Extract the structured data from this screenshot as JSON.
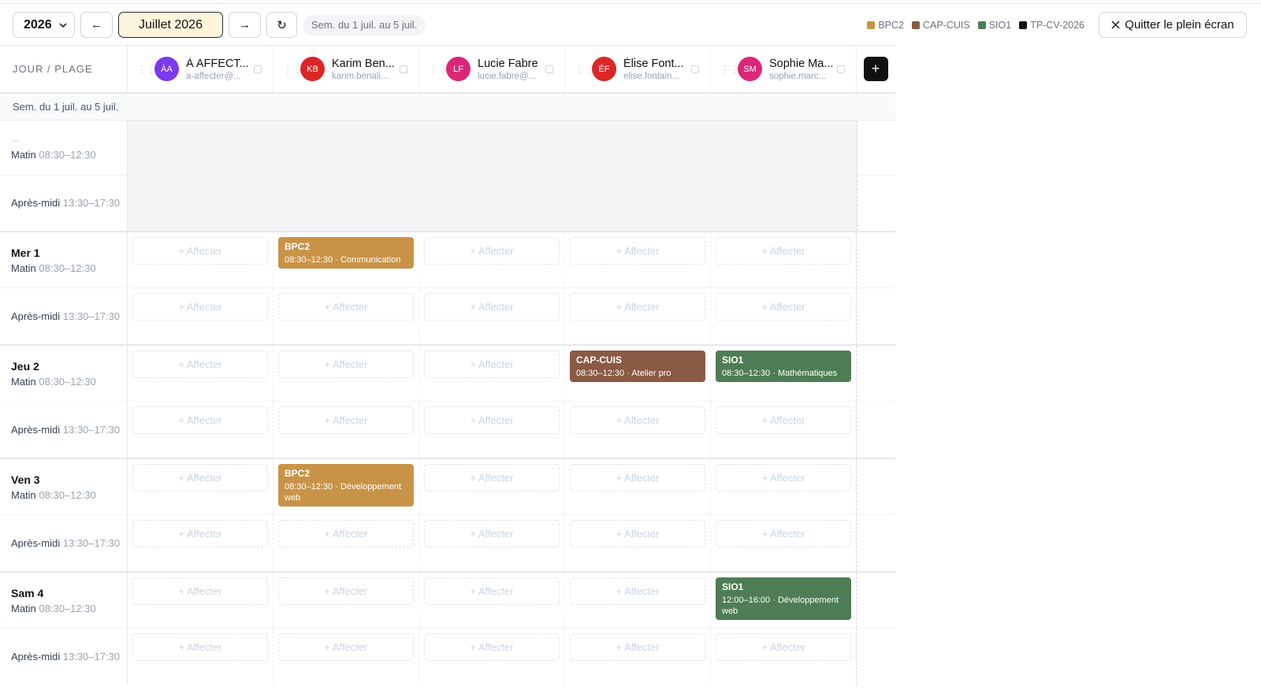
{
  "toolbar": {
    "year": "2026",
    "prev_label": "←",
    "month": "Juillet 2026",
    "next_label": "→",
    "refresh_label": "↻",
    "week_range": "Sem. du 1 juil. au 5 juil.",
    "exit_label": "Quitter le plein écran",
    "legend": [
      {
        "label": "BPC2",
        "color": "#c99347"
      },
      {
        "label": "CAP-CUIS",
        "color": "#8b5a44"
      },
      {
        "label": "SIO1",
        "color": "#4e7d55"
      },
      {
        "label": "TP-CV-2026",
        "color": "#111111"
      }
    ]
  },
  "grid": {
    "corner_label": "JOUR / PLAGE",
    "week_label": "Sem. du 1 juil. au 5 juil.",
    "add_label": "+",
    "affect_label": "+ Affecter",
    "teachers": [
      {
        "initials": "ÀA",
        "name": "À AFFECT...",
        "email": "a-affecter@...",
        "color": "#7c3aed"
      },
      {
        "initials": "KB",
        "name": "Karim Ben...",
        "email": "karim.benali...",
        "color": "#dc2626"
      },
      {
        "initials": "LF",
        "name": "Lucie Fabre",
        "email": "lucie.fabre@...",
        "color": "#db2777"
      },
      {
        "initials": "ÉF",
        "name": "Élise Font...",
        "email": "elise.fontain...",
        "color": "#dc2626"
      },
      {
        "initials": "SM",
        "name": "Sophie Ma...",
        "email": "sophie.marc...",
        "color": "#db2777"
      }
    ],
    "first_block": {
      "dash": "—",
      "matin": "Matin",
      "matin_time": "08:30–12:30",
      "aprem": "Après-midi",
      "aprem_time": "13:30–17:30"
    },
    "days": [
      {
        "name": "Mer 1",
        "matin": "Matin",
        "matin_time": "08:30–12:30",
        "aprem": "Après-midi",
        "aprem_time": "13:30–17:30"
      },
      {
        "name": "Jeu 2",
        "matin": "Matin",
        "matin_time": "08:30–12:30",
        "aprem": "Après-midi",
        "aprem_time": "13:30–17:30"
      },
      {
        "name": "Ven 3",
        "matin": "Matin",
        "matin_time": "08:30–12:30",
        "aprem": "Après-midi",
        "aprem_time": "13:30–17:30"
      },
      {
        "name": "Sam 4",
        "matin": "Matin",
        "matin_time": "08:30–12:30",
        "aprem": "Après-midi",
        "aprem_time": "13:30–17:30"
      }
    ],
    "events": {
      "mer_kb": {
        "class": "BPC2",
        "detail": "08:30–12:30 · Communication",
        "color": "#c99347"
      },
      "jeu_ef": {
        "class": "CAP-CUIS",
        "detail": "08:30–12:30 · Atelier pro",
        "color": "#8b5a44"
      },
      "jeu_sm": {
        "class": "SIO1",
        "detail": "08:30–12:30 · Mathématiques",
        "color": "#4e7d55"
      },
      "ven_kb": {
        "class": "BPC2",
        "detail": "08:30–12:30 · Développement web",
        "color": "#c99347"
      },
      "sam_sm": {
        "class": "SIO1",
        "detail": "12:00–16:00 · Développement web",
        "color": "#4e7d55"
      }
    }
  }
}
